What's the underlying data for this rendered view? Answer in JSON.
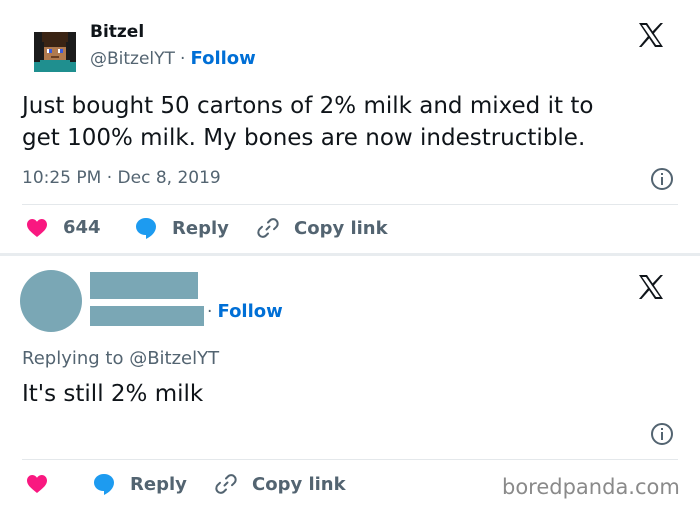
{
  "tweet": {
    "author_name": "Bitzel",
    "author_handle": "@BitzelYT",
    "separator": "·",
    "follow_label": "Follow",
    "text_lines": [
      "Just bought 50 cartons of 2% milk and mixed it to",
      "get 100% milk. My bones are now indestructible."
    ],
    "time": "10:25 PM",
    "date_separator": "·",
    "date": "Dec 8, 2019",
    "like_count": "644",
    "reply_label": "Reply",
    "copy_link_label": "Copy link"
  },
  "reply_tweet": {
    "separator": "·",
    "follow_label": "Follow",
    "replying_to": "Replying to @BitzelYT",
    "text": "It's still 2% milk",
    "reply_label": "Reply",
    "copy_link_label": "Copy link"
  },
  "watermark": "boredpanda.com",
  "colors": {
    "like": "#f91880",
    "reply": "#1d9bf0",
    "follow": "#006fd6",
    "redaction": "#7aa7b5"
  },
  "icons": [
    "x-logo-icon",
    "info-icon",
    "heart-icon",
    "reply-bubble-icon",
    "link-icon"
  ]
}
